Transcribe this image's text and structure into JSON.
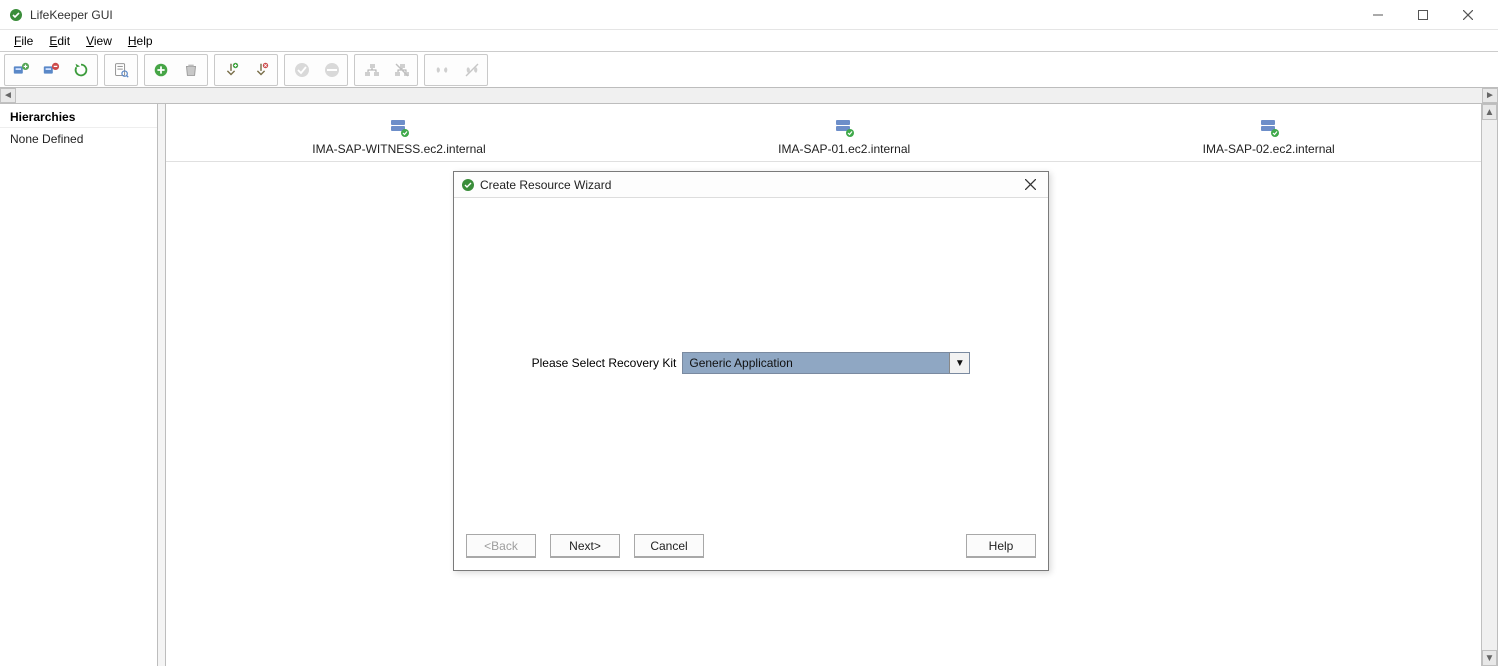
{
  "app": {
    "title": "LifeKeeper GUI"
  },
  "menus": {
    "file": "File",
    "edit": "Edit",
    "view": "View",
    "help": "Help"
  },
  "toolbar": {
    "icons": {
      "connect": "connect-server-icon",
      "disconnect": "disconnect-server-icon",
      "refresh": "refresh-icon",
      "log": "view-log-icon",
      "create": "create-resource-icon",
      "delete": "delete-resource-icon",
      "extend": "extend-hierarchy-icon",
      "unextend": "unextend-hierarchy-icon",
      "inservice": "in-service-icon",
      "outservice": "out-of-service-icon",
      "dep_add": "add-dependency-icon",
      "dep_remove": "remove-dependency-icon",
      "link": "create-comm-path-icon",
      "unlink": "delete-comm-path-icon"
    }
  },
  "sidebar": {
    "heading": "Hierarchies",
    "status": "None Defined"
  },
  "servers": [
    {
      "name": "IMA-SAP-WITNESS.ec2.internal"
    },
    {
      "name": "IMA-SAP-01.ec2.internal"
    },
    {
      "name": "IMA-SAP-02.ec2.internal"
    }
  ],
  "dialog": {
    "title": "Create Resource Wizard",
    "prompt": "Please Select Recovery Kit",
    "selected_value": "Generic Application",
    "buttons": {
      "back": "<Back",
      "next": "Next>",
      "cancel": "Cancel",
      "help": "Help"
    }
  }
}
